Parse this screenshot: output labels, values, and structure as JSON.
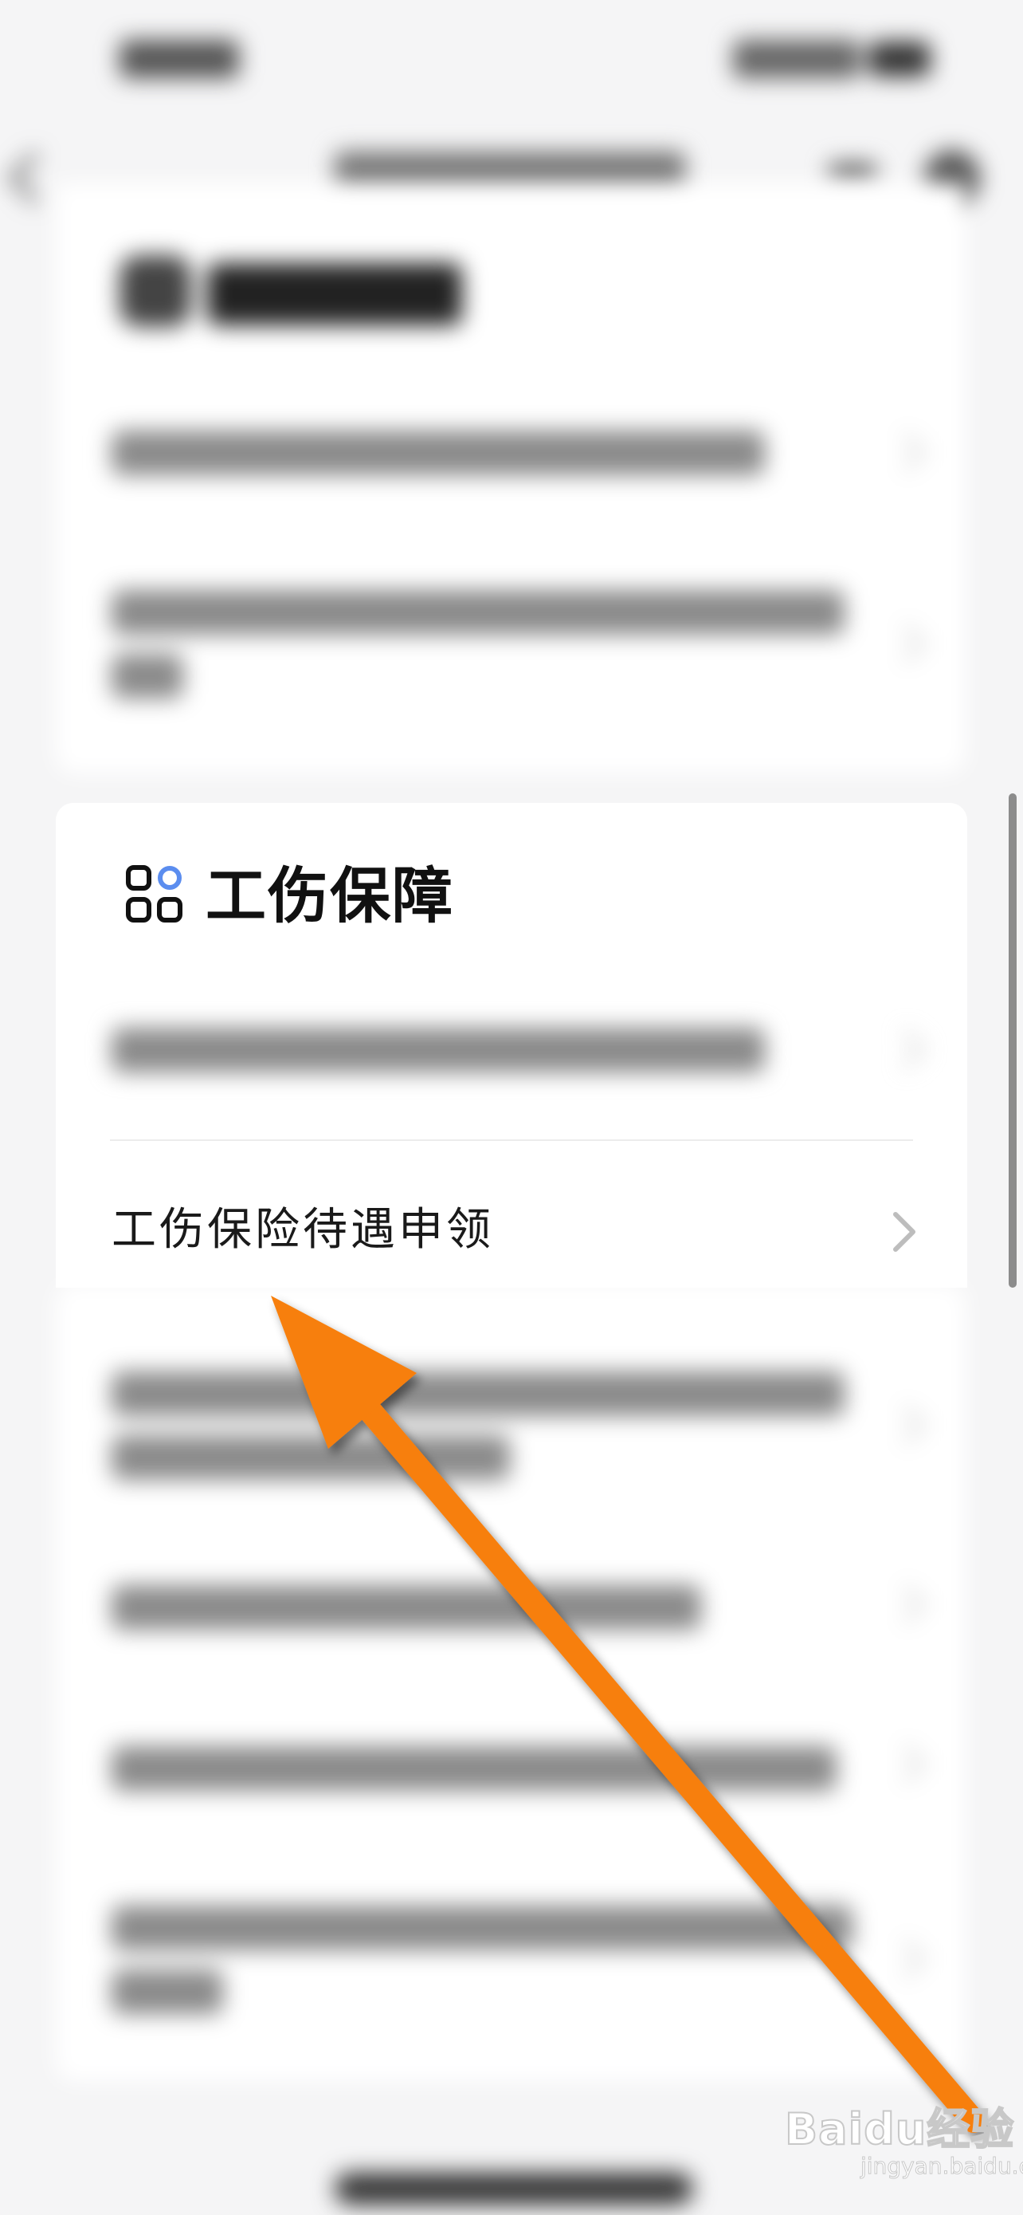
{
  "section": {
    "title": "工伤保障",
    "item": {
      "label": "工伤保险待遇申领"
    }
  },
  "watermark": {
    "brand": "Baidu经验",
    "sub": "jingyan.baidu.com"
  },
  "colors": {
    "accent_blue": "#5b8def",
    "arrow_orange": "#f77f0a",
    "text_primary": "#111111",
    "chevron_gray": "#bdbdbd"
  },
  "icons": {
    "section": "grid-apps-icon",
    "item": "chevron-right-icon",
    "annotation": "orange-arrow-annotation"
  }
}
